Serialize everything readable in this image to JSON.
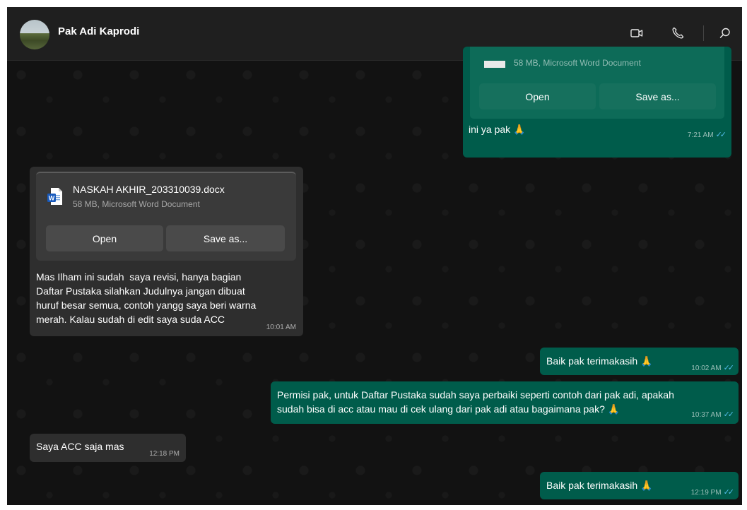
{
  "header": {
    "contact_name": "Pak Adi Kaprodi",
    "icons": [
      "video-call-icon",
      "voice-call-icon",
      "search-icon"
    ]
  },
  "messages": {
    "m1": {
      "direction": "outgoing",
      "file_meta": "58 MB, Microsoft Word Document",
      "open_label": "Open",
      "save_label": "Save as...",
      "text": "ini ya pak 🙏",
      "time": "7:21 AM",
      "status": "read"
    },
    "m2": {
      "direction": "incoming",
      "file_name": "NASKAH AKHIR_203310039.docx",
      "file_meta": "58 MB, Microsoft Word Document",
      "open_label": "Open",
      "save_label": "Save as...",
      "text": "Mas Ilham ini sudah  saya revisi, hanya bagian\nDaftar Pustaka silahkan Judulnya jangan dibuat\nhuruf besar semua, contoh yangg saya beri warna\nmerah. Kalau sudah di edit saya suda ACC",
      "time": "10:01 AM"
    },
    "m3": {
      "direction": "outgoing",
      "text": "Baik pak terimakasih 🙏",
      "time": "10:02 AM",
      "status": "read"
    },
    "m4": {
      "direction": "outgoing",
      "text": "Permisi pak, untuk Daftar Pustaka sudah saya perbaiki seperti contoh dari pak adi, apakah\nsudah bisa di acc atau mau di cek ulang dari pak adi atau bagaimana pak? 🙏",
      "time": "10:37 AM",
      "status": "read"
    },
    "m5": {
      "direction": "incoming",
      "text": "Saya ACC saja mas",
      "time": "12:18 PM"
    },
    "m6": {
      "direction": "outgoing",
      "text": "Baik pak terimakasih 🙏",
      "time": "12:19 PM",
      "status": "read"
    }
  },
  "colors": {
    "outgoing_bubble": "#005c4b",
    "incoming_bubble": "#2e2e2e",
    "read_ticks": "#53bdeb"
  }
}
